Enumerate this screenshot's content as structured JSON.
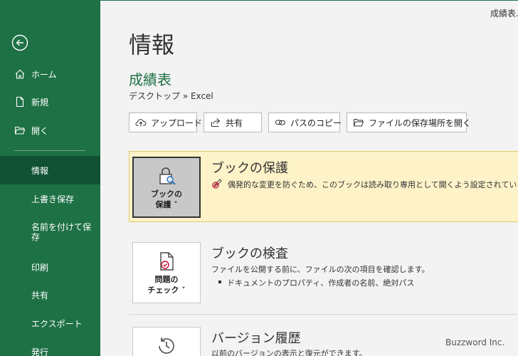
{
  "window": {
    "title": "成績表..."
  },
  "sidebar": {
    "back_icon": "back-arrow-icon",
    "items": [
      {
        "label": "ホーム",
        "icon": "home-icon"
      },
      {
        "label": "新規",
        "icon": "new-document-icon"
      },
      {
        "label": "開く",
        "icon": "folder-open-icon"
      },
      {
        "label": "情報",
        "selected": true
      },
      {
        "label": "上書き保存"
      },
      {
        "label": "名前を付けて保存"
      },
      {
        "label": "印刷"
      },
      {
        "label": "共有"
      },
      {
        "label": "エクスポート"
      },
      {
        "label": "発行"
      }
    ]
  },
  "main": {
    "title": "情報",
    "doc_name": "成績表",
    "path": "デスクトップ » Excel",
    "actions": [
      {
        "label": "アップロード",
        "icon": "upload-cloud-icon"
      },
      {
        "label": "共有",
        "icon": "share-icon"
      },
      {
        "label": "パスのコピー",
        "icon": "link-icon"
      },
      {
        "label": "ファイルの保存場所を開く",
        "icon": "folder-icon"
      }
    ],
    "protect": {
      "button_line1": "ブックの",
      "button_line2": "保護 ˅",
      "title": "ブックの保護",
      "desc": "偶発的な変更を防ぐため、このブックは読み取り専用として開くよう設定されています。",
      "desc_icon": "edit-restricted-icon"
    },
    "inspect": {
      "button_line1": "問題の",
      "button_line2": "チェック ˅",
      "title": "ブックの検査",
      "desc": "ファイルを公開する前に、ファイルの次の項目を確認します。",
      "bullet": "ドキュメントのプロパティ、作成者の名前、絶対パス"
    },
    "version": {
      "title": "バージョン履歴",
      "desc": "以前のバージョンの表示と復元ができます。"
    }
  },
  "watermark": "Buzzword Inc.",
  "colors": {
    "sidebar": "#1e7145",
    "sidebar_selected": "#0f5132",
    "accent": "#1e7145",
    "protect_bg": "#fdf2c8"
  }
}
